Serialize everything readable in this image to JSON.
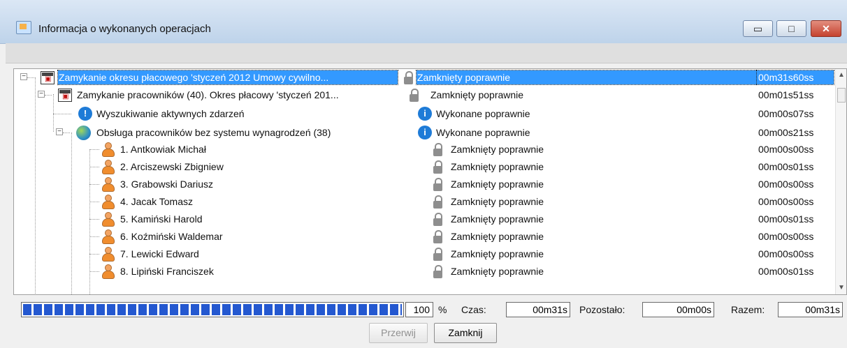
{
  "window": {
    "title": "Informacja o wykonanych operacjach",
    "controls": {
      "minimize": "▭",
      "maximize": "□",
      "close": "✕"
    }
  },
  "tree": {
    "rows": [
      {
        "name": "Zamykanie okresu płacowego 'styczeń 2012 Umowy cywilno...",
        "status": "Zamknięty poprawnie",
        "time": "00m31s60ss",
        "icon": "calendar-icon",
        "status_icon": "lock-icon",
        "selected": true
      },
      {
        "name": "Zamykanie pracowników (40). Okres płacowy 'styczeń 201...",
        "status": "Zamknięty poprawnie",
        "time": "00m01s51ss",
        "icon": "calendar-icon",
        "status_icon": "lock-icon",
        "selected": false
      },
      {
        "name": "Wyszukiwanie aktywnych zdarzeń",
        "status": "Wykonane poprawnie",
        "time": "00m00s07ss",
        "icon": "info-icon",
        "status_icon": "info-icon",
        "selected": false
      },
      {
        "name": "Obsługa pracowników bez systemu wynagrodzeń (38)",
        "status": "Wykonane poprawnie",
        "time": "00m00s21ss",
        "icon": "globe-icon",
        "status_icon": "info-icon",
        "selected": false
      },
      {
        "name": "1. Antkowiak Michał",
        "status": "Zamknięty poprawnie",
        "time": "00m00s00ss",
        "icon": "person-icon",
        "status_icon": "lock-icon",
        "selected": false
      },
      {
        "name": "2. Arciszewski Zbigniew",
        "status": "Zamknięty poprawnie",
        "time": "00m00s01ss",
        "icon": "person-icon",
        "status_icon": "lock-icon",
        "selected": false
      },
      {
        "name": "3. Grabowski Dariusz",
        "status": "Zamknięty poprawnie",
        "time": "00m00s00ss",
        "icon": "person-icon",
        "status_icon": "lock-icon",
        "selected": false
      },
      {
        "name": "4. Jacak Tomasz",
        "status": "Zamknięty poprawnie",
        "time": "00m00s00ss",
        "icon": "person-icon",
        "status_icon": "lock-icon",
        "selected": false
      },
      {
        "name": "5. Kamiński Harold",
        "status": "Zamknięty poprawnie",
        "time": "00m00s01ss",
        "icon": "person-icon",
        "status_icon": "lock-icon",
        "selected": false
      },
      {
        "name": "6. Koźmiński Waldemar",
        "status": "Zamknięty poprawnie",
        "time": "00m00s00ss",
        "icon": "person-icon",
        "status_icon": "lock-icon",
        "selected": false
      },
      {
        "name": "7. Lewicki Edward",
        "status": "Zamknięty poprawnie",
        "time": "00m00s00ss",
        "icon": "person-icon",
        "status_icon": "lock-icon",
        "selected": false
      },
      {
        "name": "8. Lipiński Franciszek",
        "status": "Zamknięty poprawnie",
        "time": "00m00s01ss",
        "icon": "person-icon",
        "status_icon": "lock-icon",
        "selected": false
      }
    ]
  },
  "progress": {
    "value_percent": 100,
    "value_label": "100",
    "percent_symbol": "%",
    "czas_label": "Czas:",
    "czas_value": "00m31s",
    "pozostalo_label": "Pozostało:",
    "pozostalo_value": "00m00s",
    "razem_label": "Razem:",
    "razem_value": "00m31s"
  },
  "buttons": {
    "przerwij": "Przerwij",
    "zamknij": "Zamknij"
  },
  "colors": {
    "selection": "#3399ff",
    "progress": "#2458d0"
  }
}
